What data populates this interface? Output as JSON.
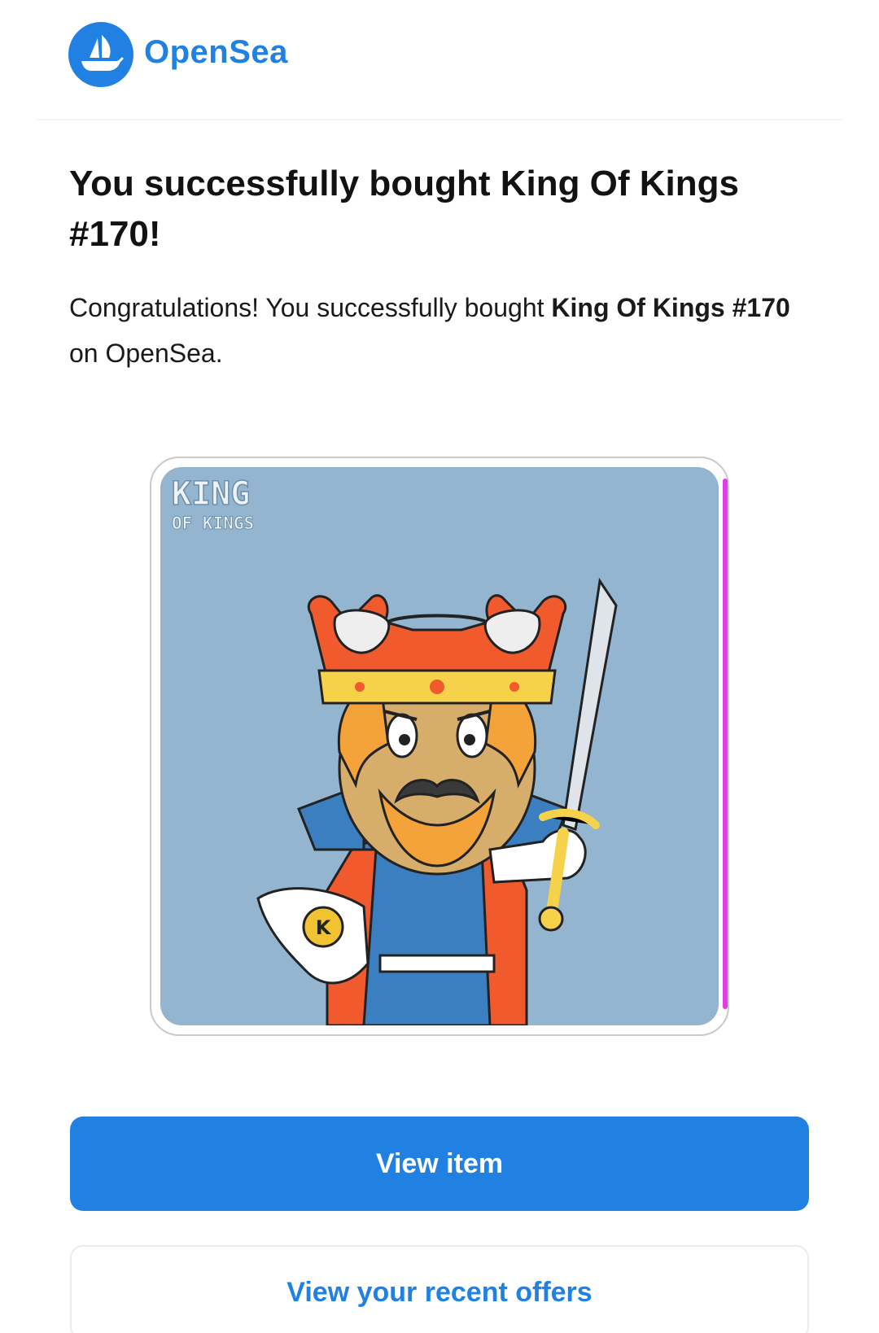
{
  "header": {
    "brand_name": "OpenSea",
    "logo_icon": "opensea-boat-icon",
    "brand_color": "#2081e2"
  },
  "notification": {
    "title": "You successfully bought King Of Kings #170!",
    "message_prefix": "Congratulations! You successfully bought ",
    "item_name": "King Of Kings #170",
    "message_suffix": " on OpenSea."
  },
  "nft": {
    "watermark_line1": "KING",
    "watermark_line2": "OF KINGS",
    "image_description_icon": "king-character-nft-image",
    "background_color": "#94b5cf",
    "accent_color": "#e23ce6"
  },
  "actions": {
    "primary_label": "View item",
    "secondary_label": "View your recent offers"
  }
}
